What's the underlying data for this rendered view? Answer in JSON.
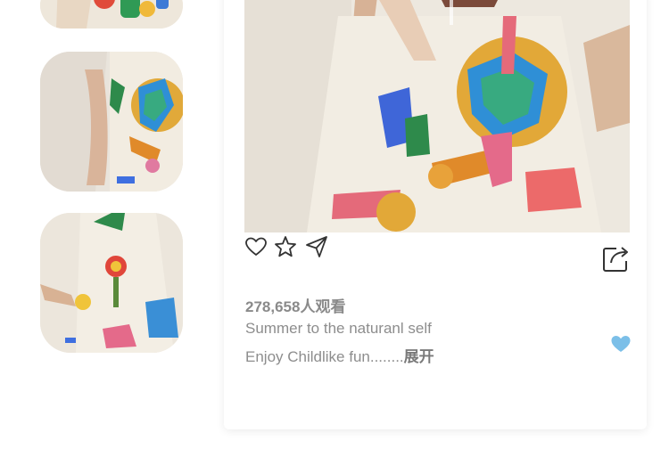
{
  "post": {
    "views": "278,658",
    "views_suffix": "人观看",
    "caption_line1": "Summer to the naturanl self",
    "caption_line2": "Enjoy Childlike fun........",
    "expand_label": "展开"
  },
  "icons": {
    "like": "heart-outline-icon",
    "favorite": "star-outline-icon",
    "send": "paper-plane-icon",
    "share": "share-icon",
    "liked": "heart-filled-icon"
  },
  "colors": {
    "accent_heart": "#7bbfe8",
    "text_gray": "#8d8d8d",
    "icon_stroke": "#333333"
  }
}
